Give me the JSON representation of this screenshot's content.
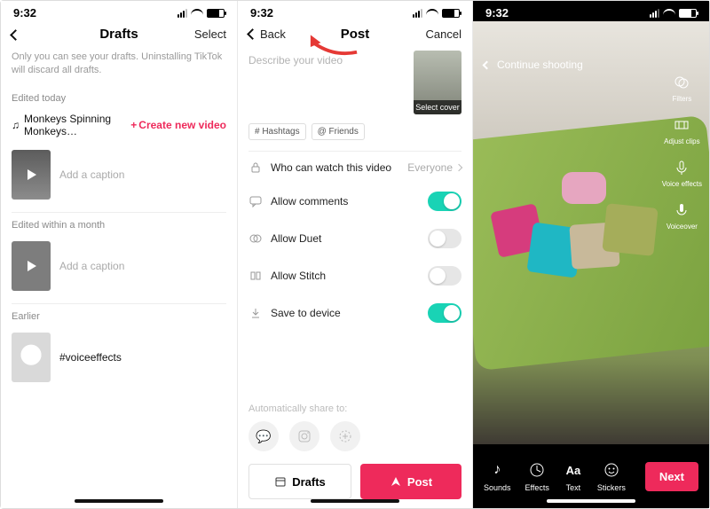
{
  "status": {
    "time": "9:32"
  },
  "drafts": {
    "title": "Drafts",
    "select": "Select",
    "notice": "Only you can see your drafts. Uninstalling TikTok will discard all drafts.",
    "sections": {
      "today": "Edited today",
      "month": "Edited within a month",
      "earlier": "Earlier"
    },
    "create": "Create new video",
    "music_title": "Monkeys Spinning Monkeys…",
    "caption_placeholder": "Add a caption",
    "earlier_caption": "#voiceeffects"
  },
  "post": {
    "back": "Back",
    "title": "Post",
    "cancel": "Cancel",
    "describe_placeholder": "Describe your video",
    "cover_label": "Select cover",
    "chips": {
      "hashtags": "# Hashtags",
      "friends": "@ Friends"
    },
    "options": {
      "who": "Who can watch this video",
      "who_value": "Everyone",
      "comments": "Allow comments",
      "duet": "Allow Duet",
      "stitch": "Allow Stitch",
      "save": "Save to device"
    },
    "toggles": {
      "comments": true,
      "duet": false,
      "stitch": false,
      "save": true
    },
    "share_label": "Automatically share to:",
    "drafts_btn": "Drafts",
    "post_btn": "Post"
  },
  "camera": {
    "continue": "Continue shooting",
    "side": {
      "filters": "Filters",
      "adjust": "Adjust clips",
      "voice": "Voice effects",
      "voiceover": "Voiceover"
    },
    "bottom": {
      "sounds": "Sounds",
      "effects": "Effects",
      "text": "Text",
      "stickers": "Stickers"
    },
    "next": "Next"
  }
}
